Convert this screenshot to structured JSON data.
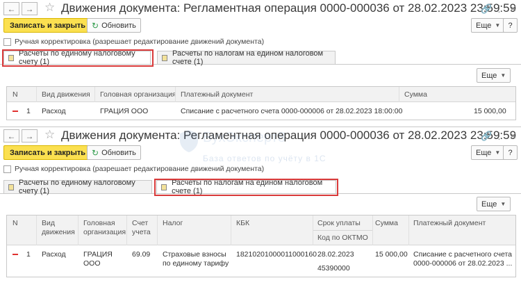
{
  "panel1": {
    "title": "Движения документа: Регламентная операция 0000-000036 от 28.02.2023 23:59:59",
    "save_close": "Записать и закрыть",
    "refresh": "Обновить",
    "more": "Еще",
    "manual": "Ручная корректировка (разрешает редактирование движений документа)",
    "tabs": [
      "Расчеты по единому налоговому счету (1)",
      "Расчеты по налогам на едином налоговом счете (1)"
    ],
    "table_more": "Еще",
    "columns": [
      "N",
      "Вид движения",
      "Головная организация",
      "Платежный документ",
      "Сумма"
    ],
    "row": {
      "n": "1",
      "kind": "Расход",
      "org": "ГРАЦИЯ ООО",
      "doc": "Списание с расчетного счета 0000-000006 от 28.02.2023 18:00:00",
      "sum": "15 000,00"
    }
  },
  "panel2": {
    "title": "Движения документа: Регламентная операция 0000-000036 от 28.02.2023 23:59:59",
    "save_close": "Записать и закрыть",
    "refresh": "Обновить",
    "more": "Еще",
    "manual": "Ручная корректировка (разрешает редактирование движений документа)",
    "tabs": [
      "Расчеты по единому налоговому счету (1)",
      "Расчеты по налогам на едином налоговом счете (1)"
    ],
    "table_more": "Еще",
    "columns": {
      "n": "N",
      "kind": [
        "Вид",
        "движения"
      ],
      "org": [
        "Головная",
        "организация"
      ],
      "account": [
        "Счет",
        "учета"
      ],
      "tax": "Налог",
      "kbk": "КБК",
      "due": "Срок уплаты",
      "oktmo": "Код по ОКТМО",
      "sum": "Сумма",
      "doc": "Платежный документ"
    },
    "row": {
      "n": "1",
      "kind": "Расход",
      "org": [
        "ГРАЦИЯ",
        "ООО"
      ],
      "account": "69.09",
      "tax": [
        "Страховые взносы",
        "по единому тарифу"
      ],
      "kbk": "18210201000011000160",
      "due": "28.02.2023",
      "oktmo": "45390000",
      "sum": "15 000,00",
      "doc": [
        "Списание с расчетного счета",
        "0000-000006 от 28.02.2023 ..."
      ]
    }
  },
  "watermark": {
    "brand": "БухЭксперт8",
    "tagline": "База ответов по учёту в 1С"
  }
}
